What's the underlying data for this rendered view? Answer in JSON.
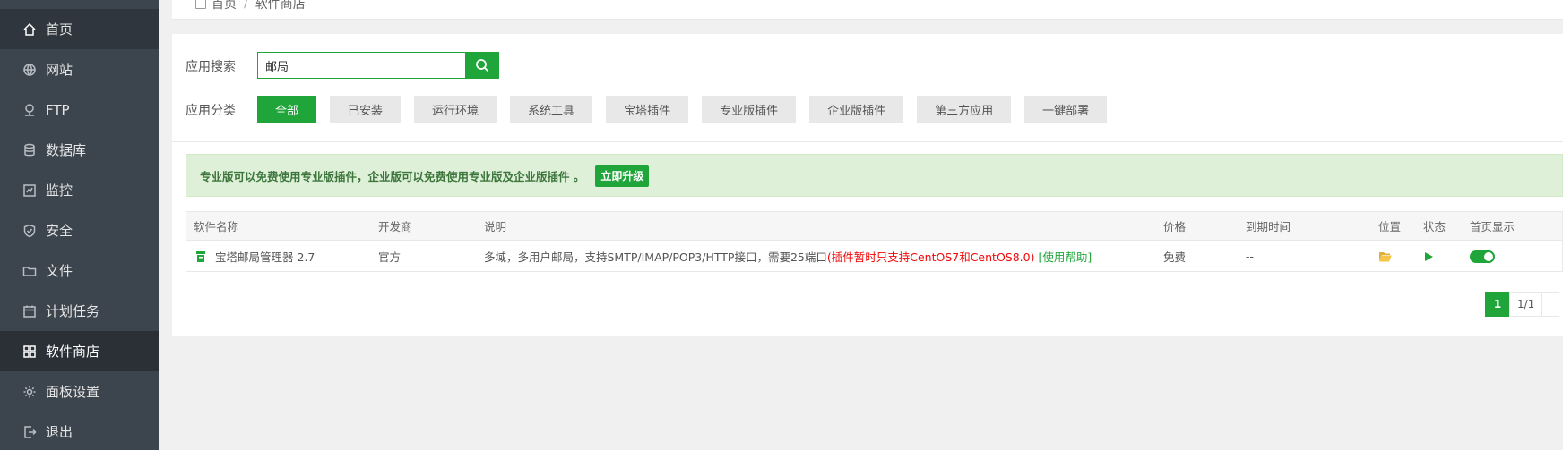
{
  "sidebar": {
    "items": [
      {
        "label": "首页",
        "icon": "home-icon"
      },
      {
        "label": "网站",
        "icon": "globe-icon"
      },
      {
        "label": "FTP",
        "icon": "ftp-icon"
      },
      {
        "label": "数据库",
        "icon": "database-icon"
      },
      {
        "label": "监控",
        "icon": "monitor-icon"
      },
      {
        "label": "安全",
        "icon": "shield-icon"
      },
      {
        "label": "文件",
        "icon": "folder-icon"
      },
      {
        "label": "计划任务",
        "icon": "calendar-icon"
      },
      {
        "label": "软件商店",
        "icon": "grid-icon"
      },
      {
        "label": "面板设置",
        "icon": "gear-icon"
      },
      {
        "label": "退出",
        "icon": "logout-icon"
      }
    ],
    "active": "软件商店"
  },
  "breadcrumb": {
    "home": "首页",
    "current": "软件商店"
  },
  "search": {
    "label": "应用搜索",
    "value": "邮局"
  },
  "categories": {
    "label": "应用分类",
    "items": [
      "全部",
      "已安装",
      "运行环境",
      "系统工具",
      "宝塔插件",
      "专业版插件",
      "企业版插件",
      "第三方应用",
      "一键部署"
    ],
    "active": "全部"
  },
  "notice": {
    "text": "专业版可以免费使用专业版插件，企业版可以免费使用专业版及企业版插件 。",
    "button": "立即升级"
  },
  "table": {
    "headers": {
      "name": "软件名称",
      "dev": "开发商",
      "desc": "说明",
      "price": "价格",
      "expire": "到期时间",
      "position": "位置",
      "state": "状态",
      "home": "首页显示"
    },
    "rows": [
      {
        "name": "宝塔邮局管理器 2.7",
        "dev": "官方",
        "desc": "多域，多用户邮局，支持SMTP/IMAP/POP3/HTTP接口，需要25端口",
        "desc_warn": "(插件暂时只支持CentOS7和CentOS8.0)",
        "desc_link": "[使用帮助]",
        "price": "免费",
        "expire": "--"
      }
    ]
  },
  "pager": {
    "current": "1",
    "summary": "1/1"
  },
  "colors": {
    "accent": "#20a53a",
    "sidebar": "#3c444d",
    "warn": "#ef0808"
  }
}
